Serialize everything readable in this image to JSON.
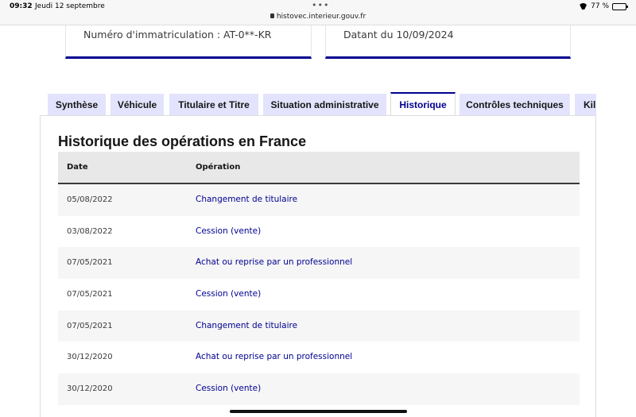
{
  "status_bar": {
    "time": "09:32",
    "date": "Jeudi 12 septembre",
    "url": "histovec.interieur.gouv.fr",
    "battery": "77 %",
    "battery_level": 0.77
  },
  "cards": {
    "registration": "Numéro d'immatriculation : AT-0**-KR",
    "report_date": "Datant du 10/09/2024"
  },
  "tabs": [
    {
      "label": "Synthèse"
    },
    {
      "label": "Véhicule"
    },
    {
      "label": "Titulaire et Titre"
    },
    {
      "label": "Situation administrative"
    },
    {
      "label": "Historique",
      "active": true
    },
    {
      "label": "Contrôles techniques"
    },
    {
      "label": "Kil"
    }
  ],
  "history": {
    "title": "Historique des opérations en France",
    "columns": {
      "date": "Date",
      "operation": "Opération"
    },
    "rows": [
      {
        "date": "05/08/2022",
        "operation": "Changement de titulaire"
      },
      {
        "date": "03/08/2022",
        "operation": "Cession (vente)"
      },
      {
        "date": "07/05/2021",
        "operation": "Achat ou reprise par un professionnel"
      },
      {
        "date": "07/05/2021",
        "operation": "Cession (vente)"
      },
      {
        "date": "07/05/2021",
        "operation": "Changement de titulaire"
      },
      {
        "date": "30/12/2020",
        "operation": "Achat ou reprise par un professionnel"
      },
      {
        "date": "30/12/2020",
        "operation": "Cession (vente)"
      }
    ]
  },
  "colors": {
    "accent": "#000091",
    "tab_bg": "#e3e3fd"
  }
}
